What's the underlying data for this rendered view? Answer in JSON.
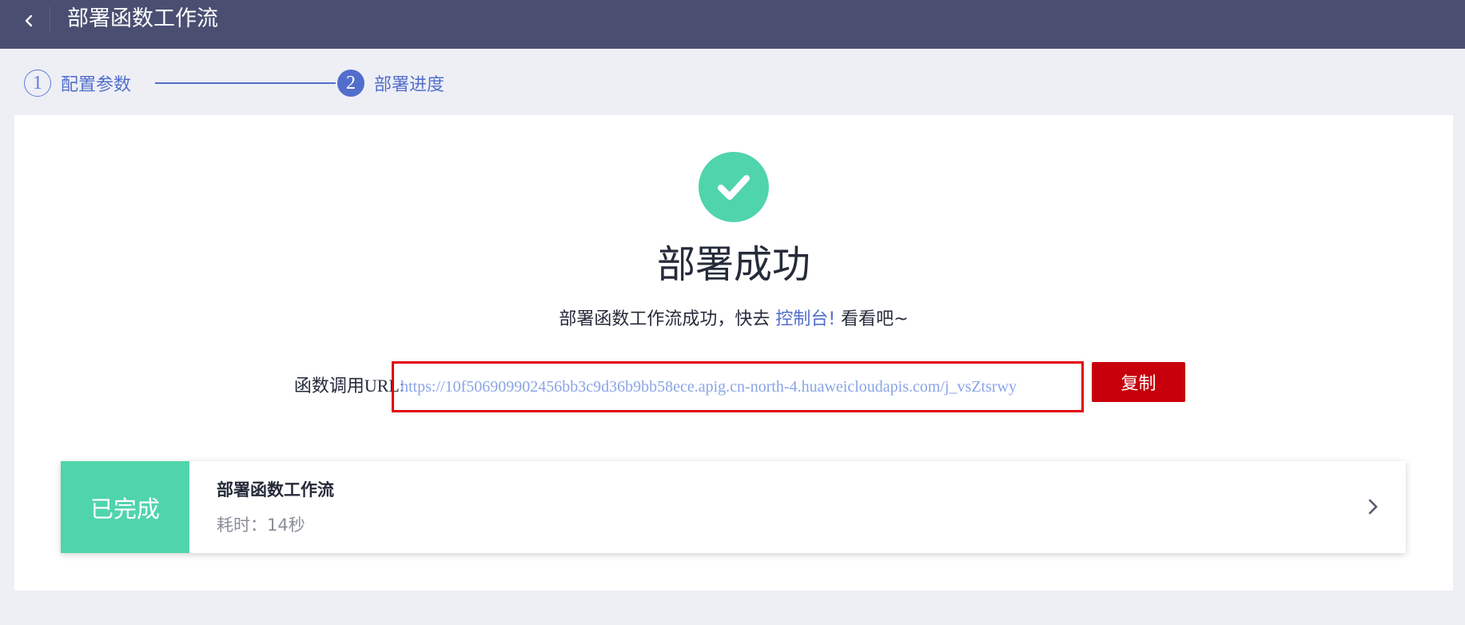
{
  "header": {
    "back_icon": "chevron-left-icon",
    "title": "部署函数工作流"
  },
  "steps": [
    {
      "number": "1",
      "label": "配置参数",
      "state": "done"
    },
    {
      "number": "2",
      "label": "部署进度",
      "state": "active"
    }
  ],
  "result": {
    "icon": "check-circle-icon",
    "title": "部署成功",
    "desc_prefix": "部署函数工作流成功，快去 ",
    "console_link": "控制台!",
    "desc_suffix": " 看看吧~"
  },
  "url": {
    "label": "函数调用URL:",
    "value": "https://10f506909902456bb3c9d36b9bb58ece.apig.cn-north-4.huaweicloudapis.com/j_vsZtsrwy",
    "copy_label": "复制"
  },
  "task": {
    "status": "已完成",
    "name": "部署函数工作流",
    "time": "耗时：14秒",
    "chevron_icon": "chevron-right-icon"
  },
  "colors": {
    "header_bg": "#4a4f72",
    "accent": "#526ecc",
    "success": "#50d4ab",
    "danger": "#c7000b",
    "highlight_border": "#e0000a"
  }
}
